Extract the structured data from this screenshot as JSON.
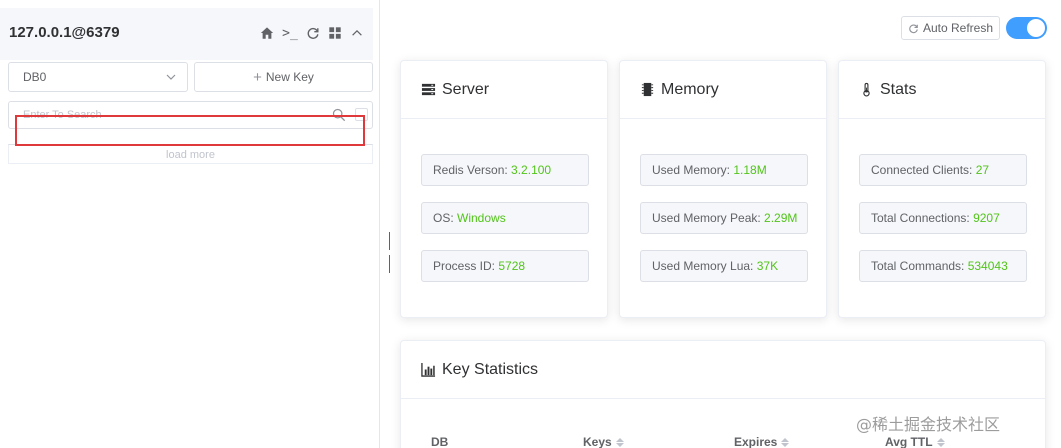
{
  "connection": {
    "title": "127.0.0.1@6379",
    "icons": [
      "home-icon",
      "terminal-icon",
      "refresh-icon",
      "grid-icon",
      "chevron-up-icon"
    ],
    "terminal_glyph": ">_"
  },
  "db_select": {
    "value": "DB0"
  },
  "new_key": {
    "label": "New Key"
  },
  "search": {
    "placeholder": "Enter To Search",
    "value": ""
  },
  "load_more": {
    "label": "load more"
  },
  "header": {
    "auto_refresh_label": "Auto Refresh",
    "auto_refresh_on": true
  },
  "server": {
    "title": "Server",
    "items": [
      {
        "label": "Redis Verson: ",
        "value": "3.2.100"
      },
      {
        "label": "OS: ",
        "value": "Windows"
      },
      {
        "label": "Process ID: ",
        "value": "5728"
      }
    ]
  },
  "memory": {
    "title": "Memory",
    "items": [
      {
        "label": "Used Memory: ",
        "value": "1.18M"
      },
      {
        "label": "Used Memory Peak: ",
        "value": "2.29M"
      },
      {
        "label": "Used Memory Lua: ",
        "value": "37K"
      }
    ]
  },
  "stats": {
    "title": "Stats",
    "items": [
      {
        "label": "Connected Clients: ",
        "value": "27"
      },
      {
        "label": "Total Connections: ",
        "value": "9207"
      },
      {
        "label": "Total Commands: ",
        "value": "534043"
      }
    ]
  },
  "key_statistics": {
    "title": "Key Statistics",
    "columns": [
      "DB",
      "Keys",
      "Expires",
      "Avg TTL"
    ]
  },
  "watermark": "@稀土掘金技术社区",
  "colors": {
    "accent": "#409eff",
    "value_green": "#52c41a",
    "highlight_red": "#e0393b"
  }
}
